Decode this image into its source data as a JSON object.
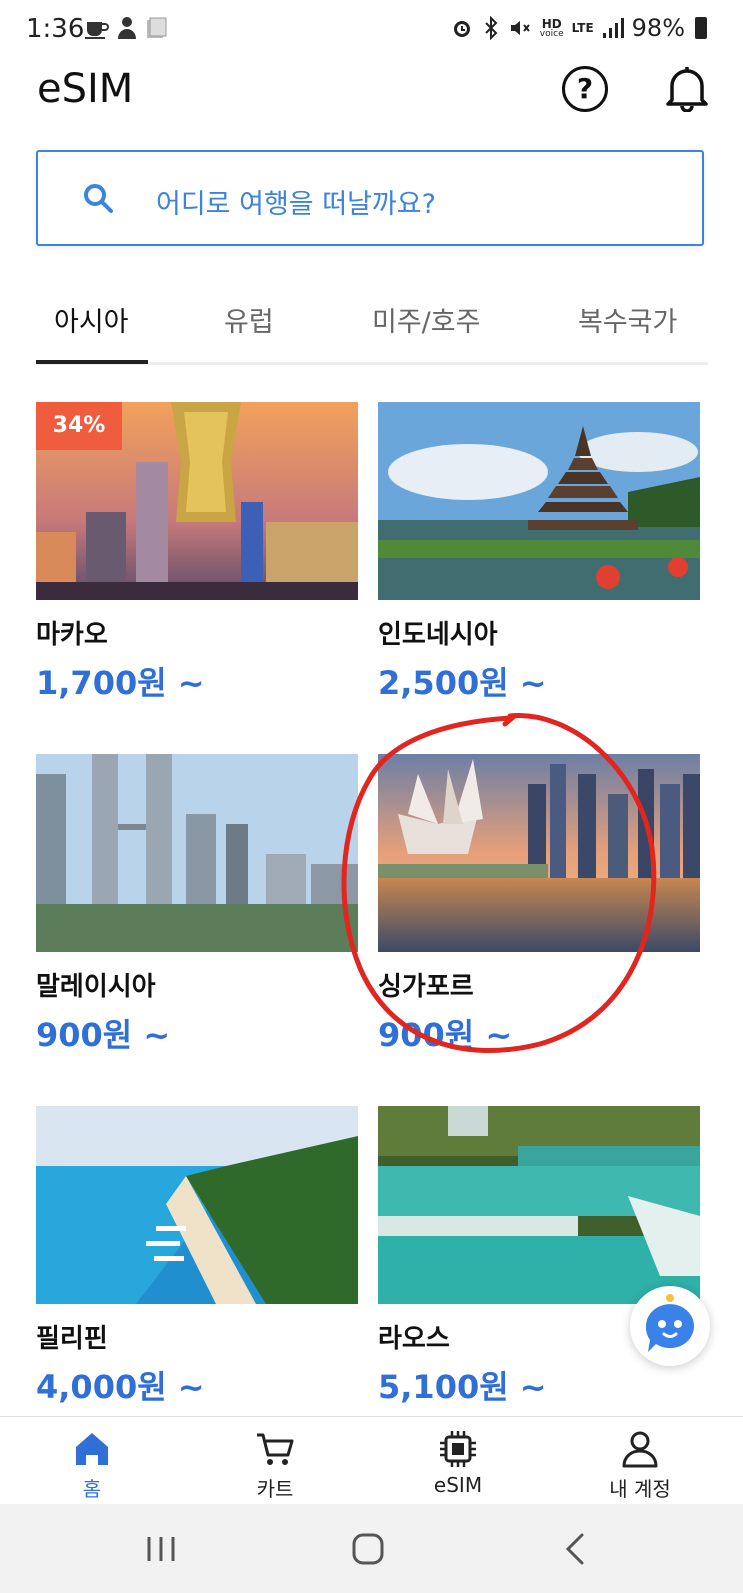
{
  "status_bar": {
    "time": "1:36",
    "left_icons": [
      "coffee-icon",
      "person-icon",
      "note-icon"
    ],
    "right_icons": [
      "alarm-icon",
      "bluetooth-icon",
      "mute-icon"
    ],
    "hd_label": "HD",
    "voice_label": "voice",
    "lte_label": "LTE",
    "battery": "98%"
  },
  "header": {
    "title": "eSIM",
    "help_icon": "question-circle-icon",
    "notification_icon": "bell-icon"
  },
  "search": {
    "placeholder": "어디로 여행을 떠날까요?",
    "accent": "#3c82e0"
  },
  "tabs": [
    {
      "label": "아시아",
      "active": true
    },
    {
      "label": "유럽",
      "active": false
    },
    {
      "label": "미주/호주",
      "active": false
    },
    {
      "label": "복수국가",
      "active": false
    }
  ],
  "products": [
    {
      "name": "마카오",
      "price": "1,700원 ~",
      "badge": "34%"
    },
    {
      "name": "인도네시아",
      "price": "2,500원 ~"
    },
    {
      "name": "말레이시아",
      "price": "900원 ~"
    },
    {
      "name": "싱가포르",
      "price": "900원 ~",
      "highlighted": true
    },
    {
      "name": "필리핀",
      "price": "4,000원 ~"
    },
    {
      "name": "라오스",
      "price": "5,100원 ~"
    }
  ],
  "colors": {
    "price": "#2f6fd6",
    "badge": "#ef5c3e",
    "annotation": "#e0261f"
  },
  "bottom_nav": [
    {
      "label": "홈",
      "icon": "home-icon",
      "active": true
    },
    {
      "label": "카트",
      "icon": "cart-icon",
      "active": false
    },
    {
      "label": "eSIM",
      "icon": "chip-icon",
      "active": false
    },
    {
      "label": "내 계정",
      "icon": "account-icon",
      "active": false
    }
  ],
  "system_nav": [
    "recent-apps-icon",
    "home-circle-icon",
    "back-icon"
  ]
}
